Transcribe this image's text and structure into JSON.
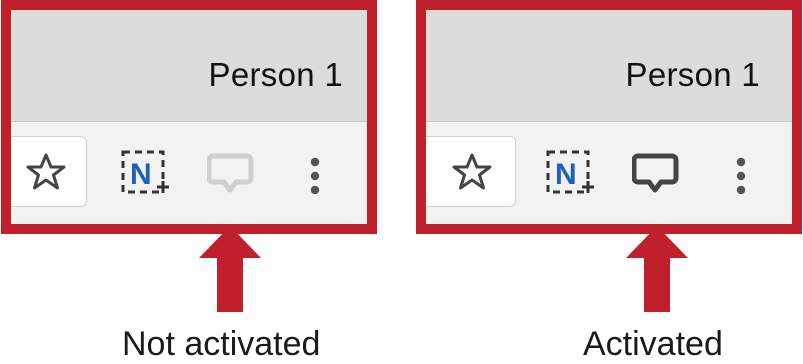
{
  "panels": [
    {
      "profile_name": "Person 1",
      "caption": "Not activated",
      "comment_state": "inactive",
      "comment_color": "#d0d0d0"
    },
    {
      "profile_name": "Person 1",
      "caption": "Activated",
      "comment_state": "active",
      "comment_color": "#444444"
    }
  ],
  "icons": {
    "bookmark": "star-icon",
    "extension": "nimbus-capture-icon",
    "comment": "comment-icon",
    "menu": "more-vertical-icon"
  },
  "colors": {
    "frame": "#c0202c",
    "extension_blue": "#1f5fbf"
  }
}
